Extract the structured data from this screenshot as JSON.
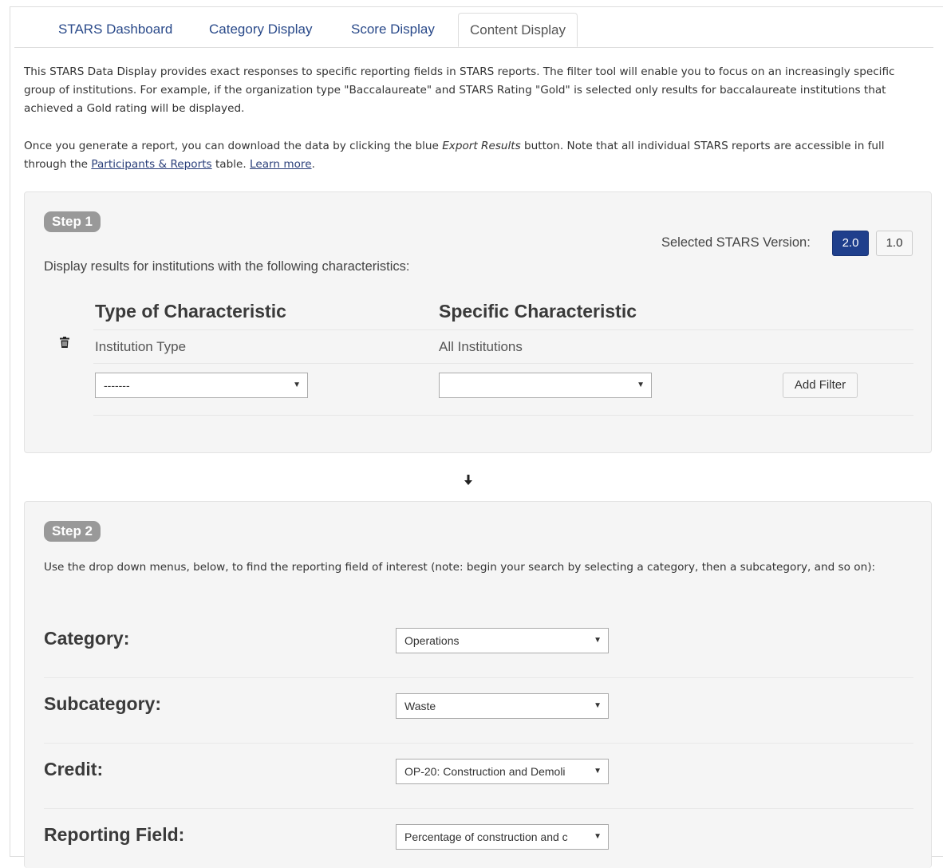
{
  "tabs": [
    {
      "label": "STARS Dashboard"
    },
    {
      "label": "Category Display"
    },
    {
      "label": "Score Display"
    },
    {
      "label": "Content Display"
    }
  ],
  "intro": {
    "p1": "This STARS Data Display provides exact responses to specific reporting fields in STARS reports. The filter tool will enable you to focus on an increasingly specific group of institutions. For example, if the organization type \"Baccalaureate\" and STARS Rating \"Gold\" is selected only results for baccalaureate institutions that achieved a Gold rating will be displayed.",
    "p2_a": "Once you generate a report, you can download the data by clicking the blue ",
    "p2_em": "Export Results",
    "p2_b": " button. Note that all individual STARS reports are accessible in full through the ",
    "p2_link1": "Participants & Reports",
    "p2_c": " table. ",
    "p2_link2": "Learn more",
    "p2_d": "."
  },
  "step1": {
    "badge": "Step 1",
    "version_label": "Selected STARS Version:",
    "version_on": "2.0",
    "version_off": "1.0",
    "description": "Display results for institutions with the following characteristics:",
    "col_type": "Type of Characteristic",
    "col_specific": "Specific Characteristic",
    "row_type": "Institution Type",
    "row_specific": "All Institutions",
    "type_select": "-------",
    "specific_select": "",
    "add_filter": "Add Filter"
  },
  "step2": {
    "badge": "Step 2",
    "description": "Use the drop down menus, below, to find the reporting field of interest (note: begin your search by selecting a category, then a subcategory, and so on):",
    "fields": [
      {
        "label": "Category:",
        "value": "Operations"
      },
      {
        "label": "Subcategory:",
        "value": "Waste"
      },
      {
        "label": "Credit:",
        "value": "OP-20: Construction and Demoli"
      },
      {
        "label": "Reporting Field:",
        "value": "Percentage of construction and c"
      }
    ]
  },
  "icons": {
    "delete": "trash-icon",
    "flow": "down-arrow-icon",
    "dropdown": "caret-down-icon"
  },
  "colors": {
    "accent": "#1f3f8c",
    "link": "#2a4a8a",
    "badge": "#999999",
    "panel": "#f5f5f5"
  }
}
